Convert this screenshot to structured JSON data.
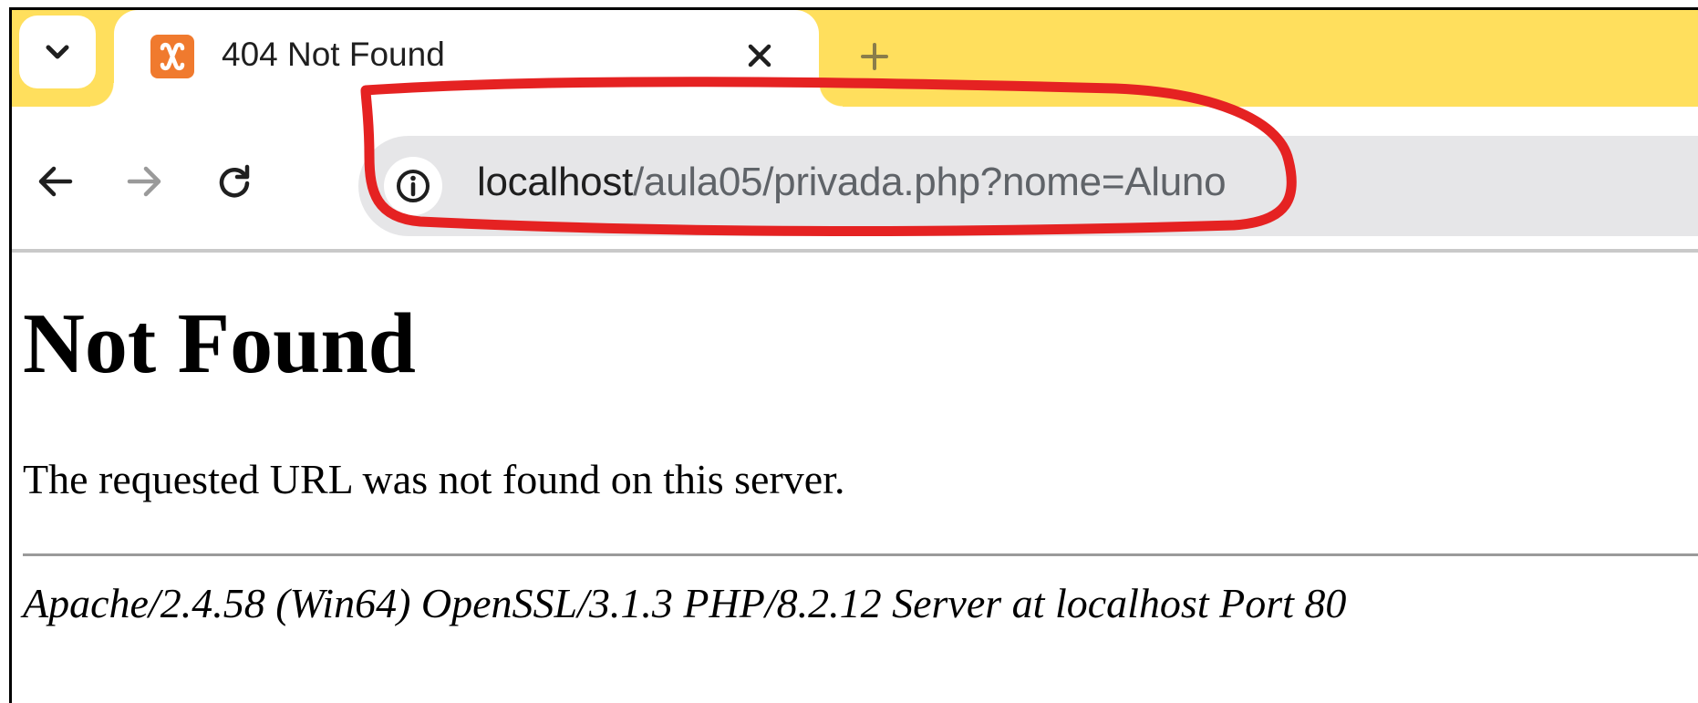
{
  "tab": {
    "title": "404 Not Found",
    "favicon": "xampp-icon"
  },
  "toolbar": {
    "url_host": "localhost",
    "url_path": "/aula05/privada.php?nome=Aluno"
  },
  "page": {
    "heading": "Not Found",
    "message": "The requested URL was not found on this server.",
    "server_signature": "Apache/2.4.58 (Win64) OpenSSL/3.1.3 PHP/8.2.12 Server at localhost Port 80"
  },
  "colors": {
    "tabstrip": "#ffdf5d",
    "favicon": "#f07a2e",
    "omnibox": "#e6e6e8",
    "annotation": "#e52222"
  }
}
